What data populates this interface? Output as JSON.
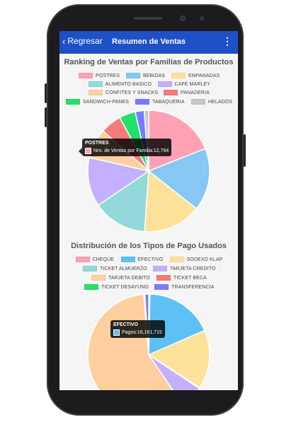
{
  "appbar": {
    "back_label": "Regresar",
    "title": "Resumen de Ventas",
    "menu_icon": "kebab-menu-icon"
  },
  "colors": {
    "appbar": "#1e50c8"
  },
  "chart_data": [
    {
      "type": "pie",
      "title": "Ranking de Ventas por Familias de Productos",
      "categories": [
        "POSTRES",
        "BEBIDAS",
        "EMPANADAS",
        "ALIMENTO BASICO",
        "CAFE MARLEY",
        "CONFITES Y SNACKS",
        "PANADERIA",
        "SANDWICH-PANES",
        "TABAQUERIA",
        "HELADOS"
      ],
      "colors": [
        "#ffa1b5",
        "#86c7f3",
        "#ffe29a",
        "#93d9d9",
        "#c4b0ff",
        "#ffcf9f",
        "#f77b7b",
        "#22e06c",
        "#7a7aff",
        "#c8c8c8"
      ],
      "values": [
        12764,
        11200,
        10400,
        9700,
        8800,
        5300,
        3800,
        2900,
        1600,
        800
      ],
      "legend_position": "top",
      "tooltip": {
        "label": "POSTRES",
        "series_name": "Nro. de Ventas por Familia",
        "value": "12,764"
      }
    },
    {
      "type": "pie",
      "title": "Distribución de los Tipos de Pago Usados",
      "categories": [
        "CHEQUE",
        "EFECTIVO",
        "SODEXO KLAP",
        "TICKET ALMUERZO",
        "TARJETA CREDITO",
        "TARJETA DEBITO",
        "TICKET BECA",
        "TICKET DESAYUNO",
        "TRANSFERENCIA"
      ],
      "colors": [
        "#ffa1b5",
        "#5ec1f5",
        "#ffe29a",
        "#93d9d9",
        "#c4b0ff",
        "#ffcf9f",
        "#f77b7b",
        "#22e06c",
        "#7a7aff"
      ],
      "values": [
        300000,
        16161715,
        14000000,
        200000,
        5500000,
        52000000,
        150000,
        100000,
        900000
      ],
      "legend_position": "top",
      "tooltip": {
        "label": "EFECTIVO",
        "series_name": "Pagos",
        "value": "16,161,715"
      }
    }
  ]
}
